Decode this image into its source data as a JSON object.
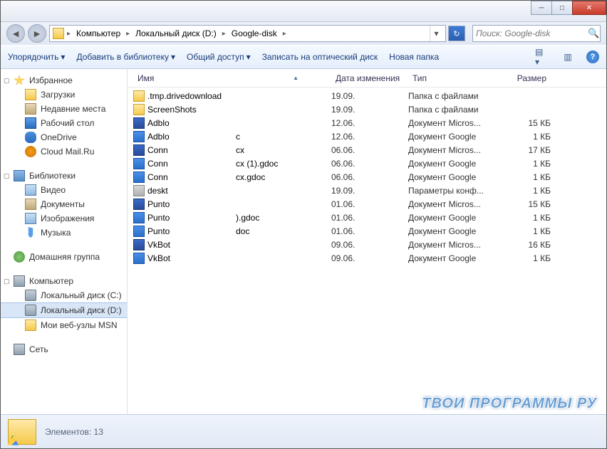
{
  "breadcrumb": {
    "p0": "Компьютер",
    "p1": "Локальный диск (D:)",
    "p2": "Google-disk"
  },
  "search": {
    "placeholder": "Поиск: Google-disk"
  },
  "toolbar": {
    "organize": "Упорядочить",
    "addlib": "Добавить в библиотеку",
    "share": "Общий доступ",
    "burn": "Записать на оптический диск",
    "newfolder": "Новая папка"
  },
  "columns": {
    "name": "Имя",
    "date": "Дата изменения",
    "type": "Тип",
    "size": "Размер"
  },
  "sidebar": {
    "fav": "Избранное",
    "fav_items": {
      "dl": "Загрузки",
      "recent": "Недавние места",
      "desk": "Рабочий стол",
      "onedrive": "OneDrive",
      "cloud": "Cloud Mail.Ru"
    },
    "lib": "Библиотеки",
    "lib_items": {
      "video": "Видео",
      "docs": "Документы",
      "img": "Изображения",
      "music": "Музыка"
    },
    "home": "Домашняя группа",
    "comp": "Компьютер",
    "comp_items": {
      "c": "Локальный диск (C:)",
      "d": "Локальный диск (D:)",
      "msn": "Мои веб-узлы MSN"
    },
    "net": "Сеть"
  },
  "files": [
    {
      "icon": "folder",
      "n1": ".tmp.drivedownload",
      "n2": "",
      "date": "19.09.",
      "type": "Папка с файлами",
      "size": ""
    },
    {
      "icon": "folder",
      "n1": "ScreenShots",
      "n2": "",
      "date": "19.09.",
      "type": "Папка с файлами",
      "size": ""
    },
    {
      "icon": "word",
      "n1": "Adblo",
      "n2": "",
      "date": "12.06.",
      "type": "Документ Micros...",
      "size": "15 КБ"
    },
    {
      "icon": "gdoc",
      "n1": "Adblo",
      "n2": "c",
      "date": "12.06.",
      "type": "Документ Google",
      "size": "1 КБ"
    },
    {
      "icon": "word",
      "n1": "Conn",
      "n2": "cx",
      "date": "06.06.",
      "type": "Документ Micros...",
      "size": "17 КБ"
    },
    {
      "icon": "gdoc",
      "n1": "Conn",
      "n2": "cx (1).gdoc",
      "date": "06.06.",
      "type": "Документ Google",
      "size": "1 КБ"
    },
    {
      "icon": "gdoc",
      "n1": "Conn",
      "n2": "cx.gdoc",
      "date": "06.06.",
      "type": "Документ Google",
      "size": "1 КБ"
    },
    {
      "icon": "ini",
      "n1": "deskt",
      "n2": "",
      "date": "19.09.",
      "type": "Параметры конф...",
      "size": "1 КБ"
    },
    {
      "icon": "word",
      "n1": "Punto",
      "n2": "",
      "date": "01.06.",
      "type": "Документ Micros...",
      "size": "15 КБ"
    },
    {
      "icon": "gdoc",
      "n1": "Punto",
      "n2": ").gdoc",
      "date": "01.06.",
      "type": "Документ Google",
      "size": "1 КБ"
    },
    {
      "icon": "gdoc",
      "n1": "Punto",
      "n2": "doc",
      "date": "01.06.",
      "type": "Документ Google",
      "size": "1 КБ"
    },
    {
      "icon": "word",
      "n1": "VkBot",
      "n2": "",
      "date": "09.06.",
      "type": "Документ Micros...",
      "size": "16 КБ"
    },
    {
      "icon": "gdoc",
      "n1": "VkBot",
      "n2": "",
      "date": "09.06.",
      "type": "Документ Google",
      "size": "1 КБ"
    }
  ],
  "status": {
    "text": "Элементов: 13"
  },
  "watermark": "ТВОИ ПРОГРАММЫ РУ"
}
